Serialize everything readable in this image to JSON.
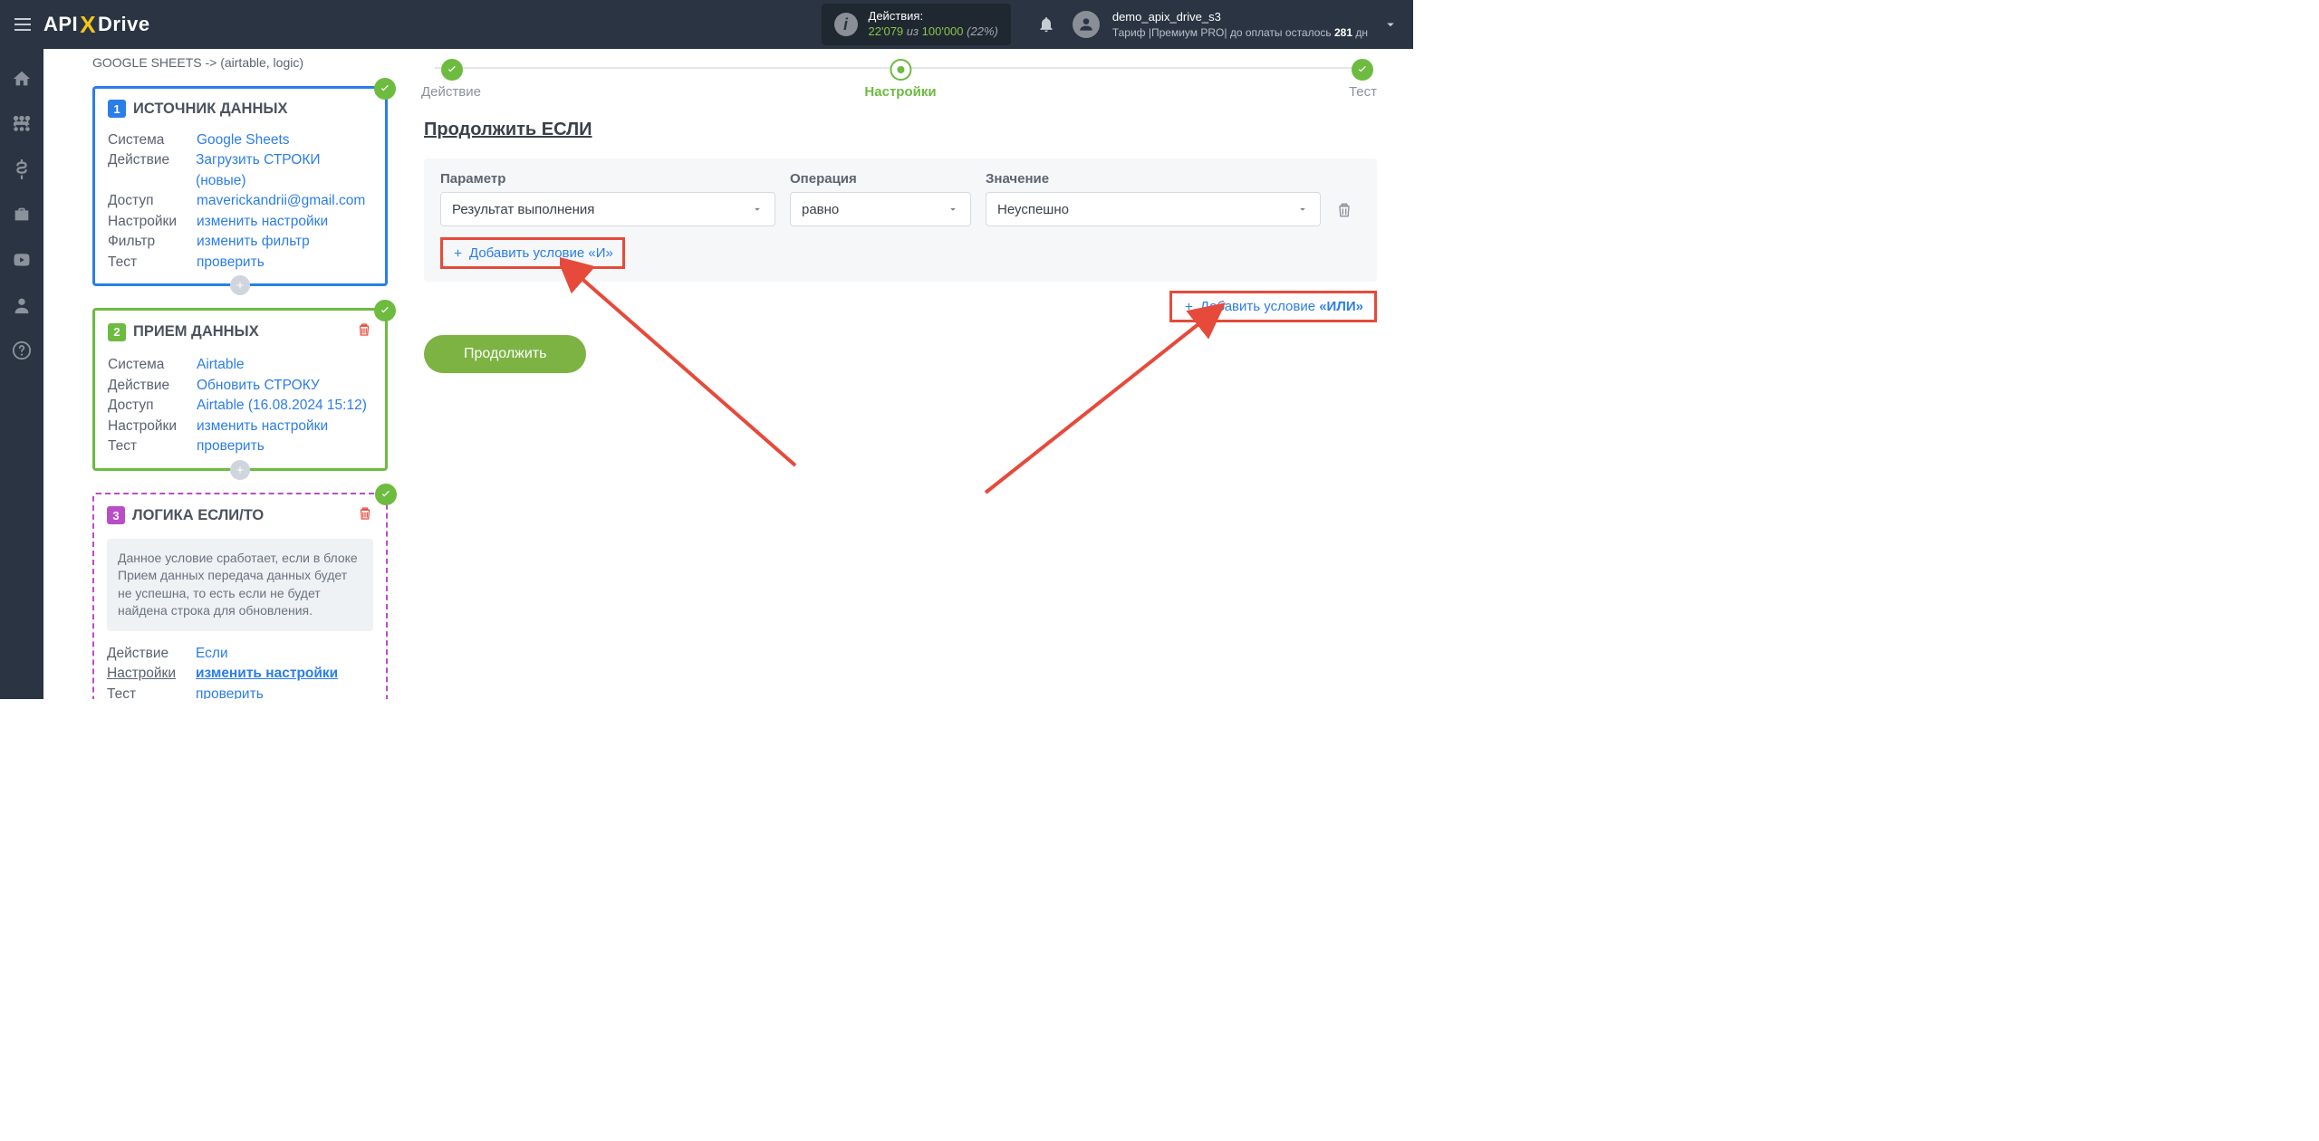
{
  "header": {
    "logo_pre": "API",
    "logo_x": "X",
    "logo_post": "Drive",
    "actions_label": "Действия:",
    "actions_used": "22'079",
    "actions_mid": " из ",
    "actions_total": "100'000",
    "actions_pct": "(22%)",
    "user_name": "demo_apix_drive_s3",
    "tariff_line_pre": "Тариф |Премиум PRO| до оплаты осталось ",
    "tariff_days": "281",
    "tariff_days_suffix": " дн"
  },
  "sidebar": {
    "breadcrumb": "GOOGLE SHEETS -> (airtable, logic)",
    "card1": {
      "title": "ИСТОЧНИК ДАННЫХ",
      "num": "1",
      "rows": {
        "sys_k": "Система",
        "sys_v": "Google Sheets",
        "act_k": "Действие",
        "act_v": "Загрузить СТРОКИ (новые)",
        "acc_k": "Доступ",
        "acc_v": "maverickandrii@gmail.com",
        "set_k": "Настройки",
        "set_v": "изменить настройки",
        "fil_k": "Фильтр",
        "fil_v": "изменить фильтр",
        "tst_k": "Тест",
        "tst_v": "проверить"
      }
    },
    "card2": {
      "title": "ПРИЕМ ДАННЫХ",
      "num": "2",
      "rows": {
        "sys_k": "Система",
        "sys_v": "Airtable",
        "act_k": "Действие",
        "act_v": "Обновить СТРОКУ",
        "acc_k": "Доступ",
        "acc_v": "Airtable (16.08.2024 15:12)",
        "set_k": "Настройки",
        "set_v": "изменить настройки",
        "tst_k": "Тест",
        "tst_v": "проверить"
      }
    },
    "card3": {
      "title": "ЛОГИКА ЕСЛИ/ТО",
      "num": "3",
      "blurb": "Данное условие сработает, если в блоке Прием данных передача данных будет не успешна, то есть если не будет найдена строка для обновления.",
      "rows": {
        "act_k": "Действие",
        "act_v": "Если",
        "set_k": "Настройки",
        "set_v": "изменить настройки",
        "tst_k": "Тест",
        "tst_v": "проверить"
      }
    }
  },
  "main": {
    "stepper": {
      "s1": "Действие",
      "s2": "Настройки",
      "s3": "Тест"
    },
    "section_title": "Продолжить ЕСЛИ",
    "labels": {
      "param": "Параметр",
      "op": "Операция",
      "val": "Значение"
    },
    "values": {
      "param": "Результат выполнения",
      "op": "равно",
      "val": "Неуспешно"
    },
    "add_and": "Добавить условие «И»",
    "add_or_pre": "Добавить условие ",
    "add_or_bold": "«ИЛИ»",
    "continue": "Продолжить"
  }
}
